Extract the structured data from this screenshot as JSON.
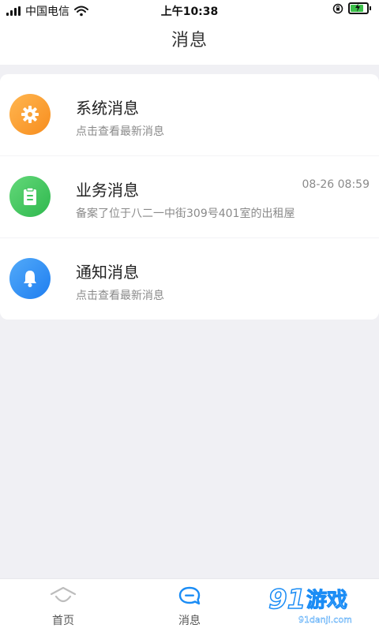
{
  "status_bar": {
    "carrier": "中国电信",
    "time": "上午10:38"
  },
  "header": {
    "title": "消息"
  },
  "messages": [
    {
      "title": "系统消息",
      "subtitle": "点击查看最新消息",
      "time": "",
      "icon": "gear-icon",
      "color_from": "#ffb650",
      "color_to": "#f78d1e"
    },
    {
      "title": "业务消息",
      "subtitle": "备案了位于八二一中街309号401室的出租屋",
      "time": "08-26 08:59",
      "icon": "clipboard-icon",
      "color_from": "#63d879",
      "color_to": "#2fb84e"
    },
    {
      "title": "通知消息",
      "subtitle": "点击查看最新消息",
      "time": "",
      "icon": "bell-icon",
      "color_from": "#52aaf9",
      "color_to": "#1f7ef0"
    }
  ],
  "tab_bar": {
    "tabs": [
      {
        "label": "首页",
        "icon": "home-icon"
      },
      {
        "label": "消息",
        "icon": "message-icon"
      }
    ]
  },
  "watermark": {
    "brand": "91游戏",
    "site": "91danji.com"
  }
}
